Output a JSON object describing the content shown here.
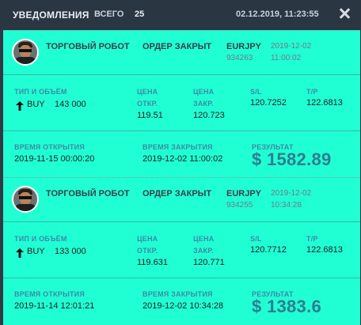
{
  "header": {
    "title": "УВЕДОМЛЕНИЯ",
    "total_label": "ВСЕГО",
    "total_count": "25",
    "timestamp": "02.12.2019, 11:23:55"
  },
  "notifications": [
    {
      "robot": "ТОРГОВЫЙ РОБОТ",
      "event": "ОРДЕР ЗАКРЫТ",
      "symbol": "EURJPY",
      "order_id": "934263",
      "date": "2019-12-02",
      "time": "11:00:02",
      "labels": {
        "type_volume": "ТИП И ОБЪЁМ",
        "open_price_1": "ЦЕНА",
        "open_price_2": "ОТКР.",
        "close_price_1": "ЦЕНА",
        "close_price_2": "ЗАКР.",
        "sl": "S/L",
        "tp": "T/P",
        "open_time": "ВРЕМЯ ОТКРЫТИЯ",
        "close_time": "ВРЕМЯ ЗАКРЫТИЯ",
        "result": "РЕЗУЛЬТАТ"
      },
      "direction": "BUY",
      "volume": "143 000",
      "open_price": "119.51",
      "close_price": "120.723",
      "sl": "120.7252",
      "tp": "122.6813",
      "open_time": "2019-11-15 00:00:20",
      "close_time": "2019-12-02 11:00:02",
      "result": "$ 1582.89"
    },
    {
      "robot": "ТОРГОВЫЙ РОБОТ",
      "event": "ОРДЕР ЗАКРЫТ",
      "symbol": "EURJPY",
      "order_id": "934255",
      "date": "2019-12-02",
      "time": "10:34:28",
      "labels": {
        "type_volume": "ТИП И ОБЪЁМ",
        "open_price_1": "ЦЕНА",
        "open_price_2": "ОТКР.",
        "close_price_1": "ЦЕНА",
        "close_price_2": "ЗАКР.",
        "sl": "S/L",
        "tp": "T/P",
        "open_time": "ВРЕМЯ ОТКРЫТИЯ",
        "close_time": "ВРЕМЯ ЗАКРЫТИЯ",
        "result": "РЕЗУЛЬТАТ"
      },
      "direction": "BUY",
      "volume": "133 000",
      "open_price": "119.631",
      "close_price": "120.771",
      "sl": "120.7712",
      "tp": "122.6813",
      "open_time": "2019-11-14 12:01:21",
      "close_time": "2019-12-02 10:34:28",
      "result": "$ 1383.6"
    }
  ],
  "colors": {
    "card_bg": "#20ffd4",
    "header_bg": "#2b3643",
    "label": "#3c8aa4",
    "result": "#2e7d8f"
  }
}
